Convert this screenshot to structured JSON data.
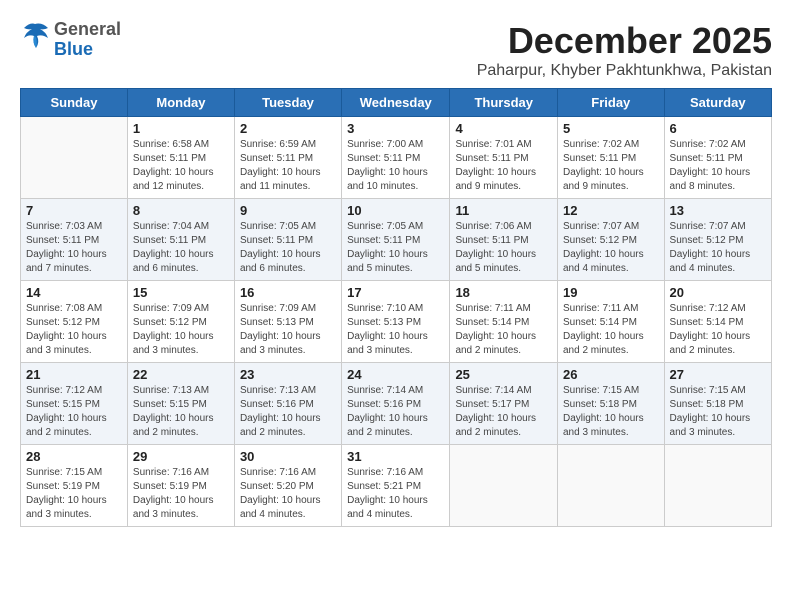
{
  "header": {
    "logo_general": "General",
    "logo_blue": "Blue",
    "month_year": "December 2025",
    "location": "Paharpur, Khyber Pakhtunkhwa, Pakistan"
  },
  "weekdays": [
    "Sunday",
    "Monday",
    "Tuesday",
    "Wednesday",
    "Thursday",
    "Friday",
    "Saturday"
  ],
  "weeks": [
    [
      {
        "day": null,
        "info": null
      },
      {
        "day": "1",
        "info": "Sunrise: 6:58 AM\nSunset: 5:11 PM\nDaylight: 10 hours\nand 12 minutes."
      },
      {
        "day": "2",
        "info": "Sunrise: 6:59 AM\nSunset: 5:11 PM\nDaylight: 10 hours\nand 11 minutes."
      },
      {
        "day": "3",
        "info": "Sunrise: 7:00 AM\nSunset: 5:11 PM\nDaylight: 10 hours\nand 10 minutes."
      },
      {
        "day": "4",
        "info": "Sunrise: 7:01 AM\nSunset: 5:11 PM\nDaylight: 10 hours\nand 9 minutes."
      },
      {
        "day": "5",
        "info": "Sunrise: 7:02 AM\nSunset: 5:11 PM\nDaylight: 10 hours\nand 9 minutes."
      },
      {
        "day": "6",
        "info": "Sunrise: 7:02 AM\nSunset: 5:11 PM\nDaylight: 10 hours\nand 8 minutes."
      }
    ],
    [
      {
        "day": "7",
        "info": "Sunrise: 7:03 AM\nSunset: 5:11 PM\nDaylight: 10 hours\nand 7 minutes."
      },
      {
        "day": "8",
        "info": "Sunrise: 7:04 AM\nSunset: 5:11 PM\nDaylight: 10 hours\nand 6 minutes."
      },
      {
        "day": "9",
        "info": "Sunrise: 7:05 AM\nSunset: 5:11 PM\nDaylight: 10 hours\nand 6 minutes."
      },
      {
        "day": "10",
        "info": "Sunrise: 7:05 AM\nSunset: 5:11 PM\nDaylight: 10 hours\nand 5 minutes."
      },
      {
        "day": "11",
        "info": "Sunrise: 7:06 AM\nSunset: 5:11 PM\nDaylight: 10 hours\nand 5 minutes."
      },
      {
        "day": "12",
        "info": "Sunrise: 7:07 AM\nSunset: 5:12 PM\nDaylight: 10 hours\nand 4 minutes."
      },
      {
        "day": "13",
        "info": "Sunrise: 7:07 AM\nSunset: 5:12 PM\nDaylight: 10 hours\nand 4 minutes."
      }
    ],
    [
      {
        "day": "14",
        "info": "Sunrise: 7:08 AM\nSunset: 5:12 PM\nDaylight: 10 hours\nand 3 minutes."
      },
      {
        "day": "15",
        "info": "Sunrise: 7:09 AM\nSunset: 5:12 PM\nDaylight: 10 hours\nand 3 minutes."
      },
      {
        "day": "16",
        "info": "Sunrise: 7:09 AM\nSunset: 5:13 PM\nDaylight: 10 hours\nand 3 minutes."
      },
      {
        "day": "17",
        "info": "Sunrise: 7:10 AM\nSunset: 5:13 PM\nDaylight: 10 hours\nand 3 minutes."
      },
      {
        "day": "18",
        "info": "Sunrise: 7:11 AM\nSunset: 5:14 PM\nDaylight: 10 hours\nand 2 minutes."
      },
      {
        "day": "19",
        "info": "Sunrise: 7:11 AM\nSunset: 5:14 PM\nDaylight: 10 hours\nand 2 minutes."
      },
      {
        "day": "20",
        "info": "Sunrise: 7:12 AM\nSunset: 5:14 PM\nDaylight: 10 hours\nand 2 minutes."
      }
    ],
    [
      {
        "day": "21",
        "info": "Sunrise: 7:12 AM\nSunset: 5:15 PM\nDaylight: 10 hours\nand 2 minutes."
      },
      {
        "day": "22",
        "info": "Sunrise: 7:13 AM\nSunset: 5:15 PM\nDaylight: 10 hours\nand 2 minutes."
      },
      {
        "day": "23",
        "info": "Sunrise: 7:13 AM\nSunset: 5:16 PM\nDaylight: 10 hours\nand 2 minutes."
      },
      {
        "day": "24",
        "info": "Sunrise: 7:14 AM\nSunset: 5:16 PM\nDaylight: 10 hours\nand 2 minutes."
      },
      {
        "day": "25",
        "info": "Sunrise: 7:14 AM\nSunset: 5:17 PM\nDaylight: 10 hours\nand 2 minutes."
      },
      {
        "day": "26",
        "info": "Sunrise: 7:15 AM\nSunset: 5:18 PM\nDaylight: 10 hours\nand 3 minutes."
      },
      {
        "day": "27",
        "info": "Sunrise: 7:15 AM\nSunset: 5:18 PM\nDaylight: 10 hours\nand 3 minutes."
      }
    ],
    [
      {
        "day": "28",
        "info": "Sunrise: 7:15 AM\nSunset: 5:19 PM\nDaylight: 10 hours\nand 3 minutes."
      },
      {
        "day": "29",
        "info": "Sunrise: 7:16 AM\nSunset: 5:19 PM\nDaylight: 10 hours\nand 3 minutes."
      },
      {
        "day": "30",
        "info": "Sunrise: 7:16 AM\nSunset: 5:20 PM\nDaylight: 10 hours\nand 4 minutes."
      },
      {
        "day": "31",
        "info": "Sunrise: 7:16 AM\nSunset: 5:21 PM\nDaylight: 10 hours\nand 4 minutes."
      },
      {
        "day": null,
        "info": null
      },
      {
        "day": null,
        "info": null
      },
      {
        "day": null,
        "info": null
      }
    ]
  ]
}
